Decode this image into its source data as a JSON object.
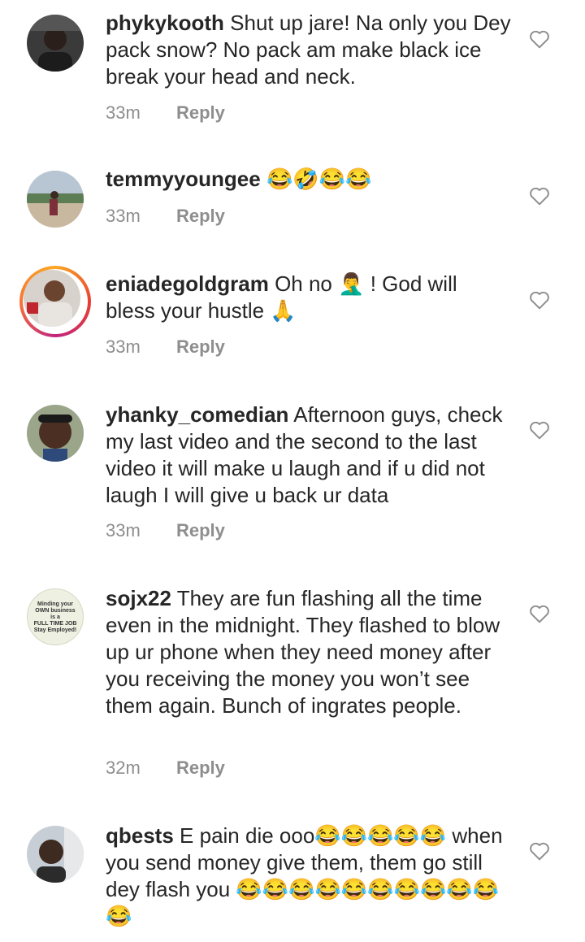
{
  "comments": [
    {
      "username": "phykykooth",
      "text": "Shut up jare! Na only you Dey pack snow? No pack am make black ice break your head and neck.",
      "time": "33m",
      "reply": "Reply"
    },
    {
      "username": "temmyyoungee",
      "text": "😂🤣😂😂",
      "time": "33m",
      "reply": "Reply"
    },
    {
      "username": "eniadegoldgram",
      "text": "Oh no 🤦‍♂️ ! God will bless your hustle 🙏",
      "time": "33m",
      "reply": "Reply"
    },
    {
      "username": "yhanky_comedian",
      "text": "Afternoon guys, check my last video and the second to the last video it will make u laugh and if u did not laugh I will give u back ur data",
      "time": "33m",
      "reply": "Reply"
    },
    {
      "username": "sojx22",
      "text": "They are fun flashing all the time even in the midnight. They flashed to blow up ur phone when they need money after you receiving the money you won’t see them again. Bunch of ingrates people.",
      "time": "32m",
      "reply": "Reply",
      "avatar_text": [
        "Minding your",
        "OWN business",
        "is a",
        "FULL TIME JOB",
        "Stay Employed!"
      ]
    },
    {
      "username": "qbests",
      "text": "E pain die ooo😂😂😂😂😂 when you send money give them, them go still dey flash you 😂😂😂😂😂😂😂😂😂😂😂",
      "time": "",
      "reply": ""
    }
  ],
  "icons": {
    "like": "heart-outline-icon"
  },
  "colors": {
    "text": "#262626",
    "meta": "#8e8e8e",
    "story_ring": "#e8402f"
  }
}
